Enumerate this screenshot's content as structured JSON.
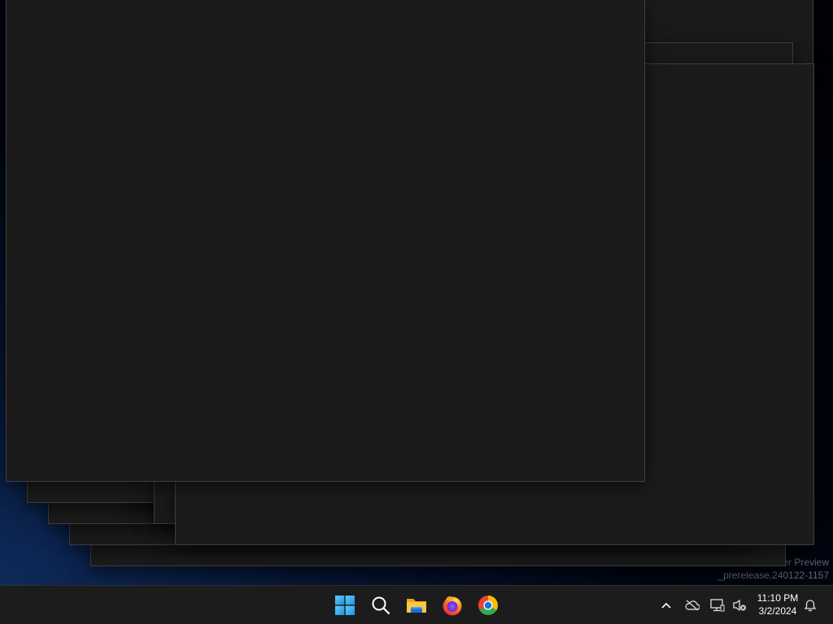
{
  "desktop": {
    "watermark": {
      "line1": "o Insider Preview",
      "line2": "_prerelease.240122-1157"
    }
  },
  "taskbar": {
    "apps": [
      {
        "name": "Start",
        "icon": "windows-logo-icon"
      },
      {
        "name": "Search",
        "icon": "search-icon"
      },
      {
        "name": "File Explorer",
        "icon": "folder-icon"
      },
      {
        "name": "Firefox",
        "icon": "firefox-icon"
      },
      {
        "name": "Chrome",
        "icon": "chrome-icon"
      }
    ],
    "tray": {
      "icons": [
        "chevron-up-icon",
        "onedrive-offline-icon",
        "network-icon",
        "volume-muted-icon",
        "notification-bell-icon"
      ],
      "time": "11:10 PM",
      "date": "3/2/2024"
    }
  },
  "colors": {
    "window_bg": "#1b1b1b",
    "window_border": "#3e3e3e",
    "taskbar_bg": "#1c1c1c",
    "start_blue": "#3ab4f2"
  }
}
